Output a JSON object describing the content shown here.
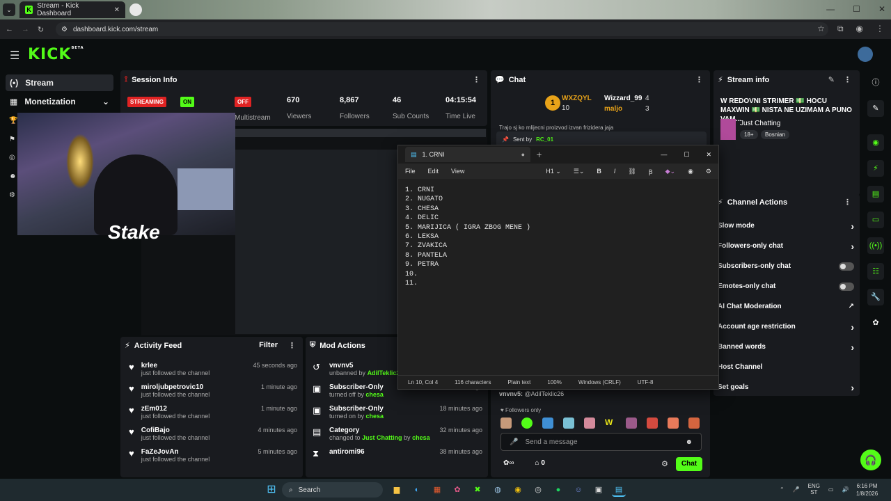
{
  "browser": {
    "tab_title": "Stream - Kick Dashboard",
    "url": "dashboard.kick.com/stream"
  },
  "kick": {
    "logo": "KICK",
    "logo_sup": "BETA"
  },
  "sidebar": {
    "items": [
      {
        "label": "Stream"
      },
      {
        "label": "Monetization"
      }
    ]
  },
  "session": {
    "title": "Session Info",
    "status_badge": "STREAMING",
    "on_badge": "ON",
    "off_badge": "OFF",
    "multistream_label": "Multistream",
    "stats": [
      {
        "value": "670",
        "label": "Viewers"
      },
      {
        "value": "8,867",
        "label": "Followers"
      },
      {
        "value": "46",
        "label": "Sub Counts"
      },
      {
        "value": "04:15:54",
        "label": "Time Live"
      }
    ]
  },
  "overlay": {
    "brand": "Stake"
  },
  "activity": {
    "title": "Activity Feed",
    "filter": "Filter",
    "items": [
      {
        "name": "krlee",
        "sub": "just followed the channel",
        "time": "45 seconds ago"
      },
      {
        "name": "miroljubpetrovic10",
        "sub": "just followed the channel",
        "time": "1 minute ago"
      },
      {
        "name": "zEm012",
        "sub": "just followed the channel",
        "time": "1 minute ago"
      },
      {
        "name": "CofiBajo",
        "sub": "just followed the channel",
        "time": "4 minutes ago"
      },
      {
        "name": "FaZeJovAn",
        "sub": "just followed the channel",
        "time": "5 minutes ago"
      }
    ]
  },
  "modactions": {
    "title": "Mod Actions",
    "items": [
      {
        "name": "vnvnv5",
        "pre": "unbanned by ",
        "by": "AdilTeklic26",
        "time": ""
      },
      {
        "name": "Subscriber-Only",
        "pre": "turned off by ",
        "by": "chesa",
        "time": "18 minutes ago"
      },
      {
        "name": "Subscriber-Only",
        "pre": "turned on by ",
        "by": "chesa",
        "time": "18 minutes ago"
      },
      {
        "name": "Category",
        "pre": "changed to ",
        "by": "Just Chatting",
        "by2": "chesa",
        "time": "32 minutes ago"
      },
      {
        "name": "antiromi96",
        "pre": "",
        "by": "",
        "time": "38 minutes ago"
      }
    ]
  },
  "chat": {
    "title": "Chat",
    "leader1_name": "WXZQYL",
    "leader1_count": "10",
    "leader2_name": "Wizzard_99",
    "leader2_count": "4",
    "leader3_name": "maljo",
    "leader3_count": "3",
    "msg_top": "Trajo sj ko mlijecni proizvod izvan frizidera jaja",
    "pinned_sent_by": "Sent by",
    "pinned_user": "RC_01",
    "msg_bottom_user": "vnvnv5:",
    "msg_bottom_text": "@AdilTeklic26",
    "followers_only": "Followers only",
    "input_placeholder": "Send a message",
    "count": "0",
    "chat_button": "Chat"
  },
  "stream_info": {
    "title": "Stream info",
    "stream_title": "W REDOVNI STRIMER 💵 HOCU MAXWIN 💵 NISTA NE UZIMAM A PUNO VAM...",
    "category": "Just Chatting",
    "tags": [
      "18+",
      "Bosnian"
    ]
  },
  "channel_actions": {
    "title": "Channel Actions",
    "items": [
      {
        "label": "Slow mode",
        "ctrl": "chevron"
      },
      {
        "label": "Followers-only chat",
        "ctrl": "chevron"
      },
      {
        "label": "Subscribers-only chat",
        "ctrl": "toggle"
      },
      {
        "label": "Emotes-only chat",
        "ctrl": "toggle"
      },
      {
        "label": "AI Chat Moderation",
        "ctrl": "external"
      },
      {
        "label": "Account age restriction",
        "ctrl": "chevron"
      },
      {
        "label": "Banned words",
        "ctrl": "chevron"
      },
      {
        "label": "Host Channel",
        "ctrl": "none"
      },
      {
        "label": "Set goals",
        "ctrl": "chevron"
      }
    ]
  },
  "notepad": {
    "tab_title": "1. CRNI",
    "menu": [
      "File",
      "Edit",
      "View"
    ],
    "heading_ctrl": "H1",
    "lines": [
      "1. CRNI",
      "2. NUGATO",
      "3. CHESA",
      "4. DELIC",
      "5. MARIJICA ( IGRA ZBOG MENE )",
      "6. LEKSA",
      "7. ZVAKICA",
      "8. PANTELA",
      "9. PETRA",
      "10.",
      "11."
    ],
    "status": [
      "Ln 10, Col 4",
      "116 characters",
      "Plain text",
      "100%",
      "Windows (CRLF)",
      "UTF-8"
    ]
  },
  "taskbar": {
    "search": "Search",
    "lang": "ENG",
    "lang2": "ST",
    "time": "6:16 PM",
    "date": "1/8/2026"
  },
  "colors": {
    "accent": "#53fc18",
    "panel": "#191b1f",
    "bg": "#0b0e0f",
    "live": "#e02323"
  }
}
